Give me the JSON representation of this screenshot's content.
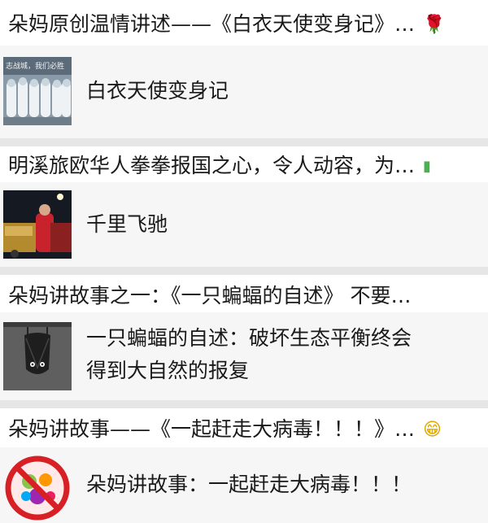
{
  "articles": [
    {
      "title": "朵妈原创温情讲述——《白衣天使变身记》…",
      "emoji": "🌹",
      "body": "白衣天使变身记",
      "thumb_caption": "志战城，我们必胜",
      "thumb_icon": "medical-team-photo"
    },
    {
      "title": "明溪旅欧华人拳拳报国之心，令人动容，为…",
      "emoji": "▮",
      "body": "千里飞驰",
      "thumb_icon": "truck-loading-photo"
    },
    {
      "title": "朵妈讲故事之一：《一只蝙蝠的自述》 不要…",
      "emoji": "",
      "body_line1": "一只蝙蝠的自述：破坏生态平衡终会",
      "body_line2": "得到大自然的报复",
      "thumb_icon": "bat-illustration"
    },
    {
      "title": "朵妈讲故事——《一起赶走大病毒！！！》…",
      "emoji": "😁",
      "body": "朵妈讲故事：一起赶走大病毒！！！",
      "thumb_icon": "no-virus-illustration"
    }
  ],
  "colors": {
    "card_bg": "#ffffff",
    "row_bg": "#f6f6f6",
    "page_bg": "#ededed",
    "text": "#1a1a1a",
    "rose_red": "#d7263d",
    "battery_green": "#4caf50"
  }
}
